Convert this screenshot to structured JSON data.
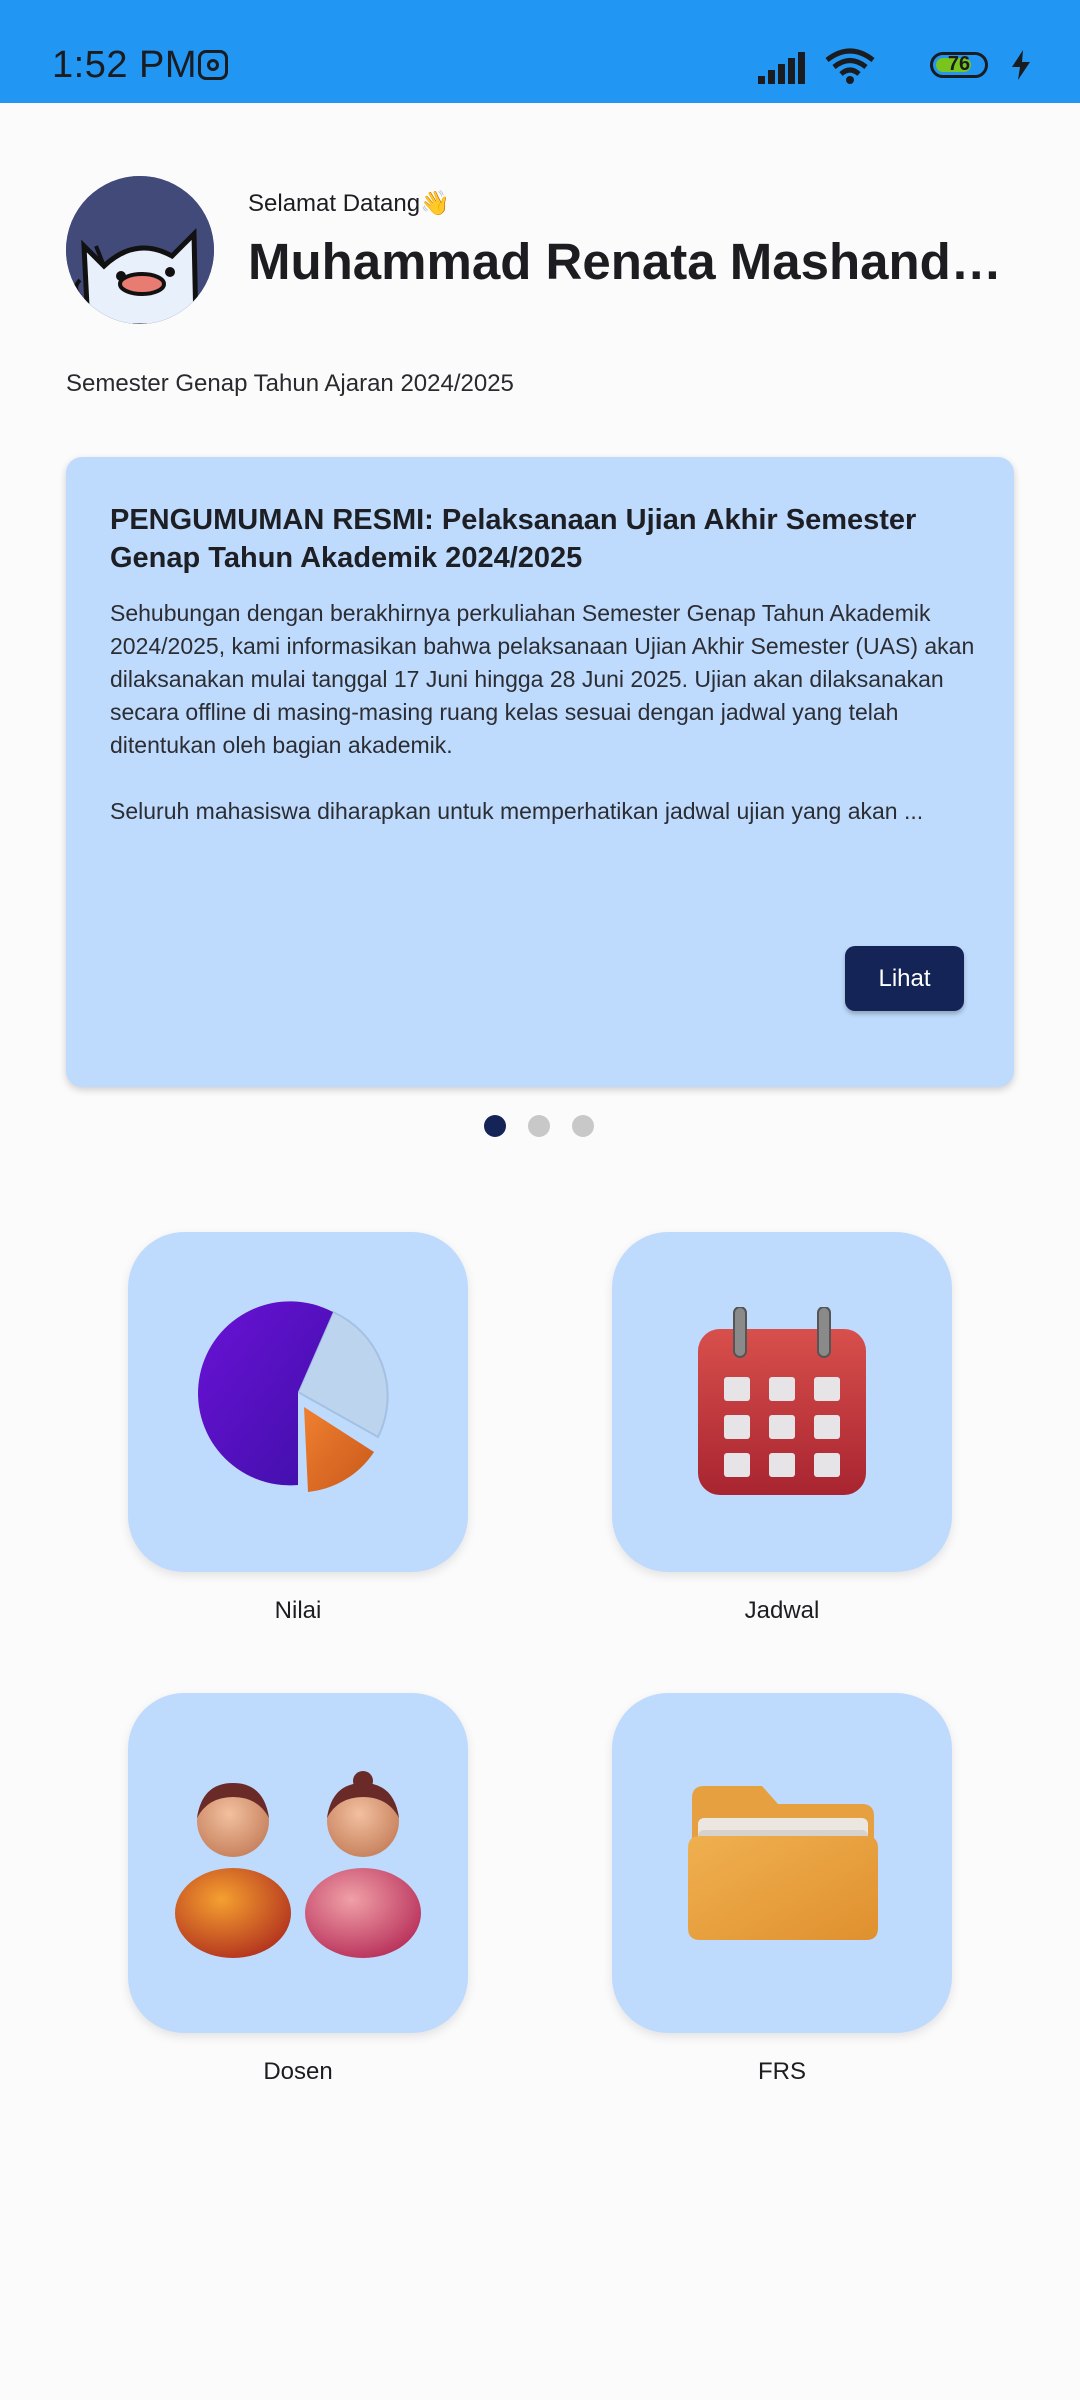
{
  "status_bar": {
    "time": "1:52 PM",
    "battery_level": "76",
    "battery_fraction": 0.76,
    "icons": [
      "notification-icon",
      "signal-icon",
      "wifi-icon",
      "battery-icon",
      "charging-icon"
    ]
  },
  "header": {
    "greeting": "Selamat Datang👋",
    "name": "Muhammad Renata Mashanda Putra",
    "semester": "Semester Genap Tahun Ajaran 2024/2025"
  },
  "announcement": {
    "title": "PENGUMUMAN RESMI: Pelaksanaan Ujian Akhir Semester Genap Tahun Akademik 2024/2025",
    "paragraph1": "Sehubungan dengan berakhirnya perkuliahan Semester Genap Tahun Akademik 2024/2025, kami informasikan bahwa pelaksanaan Ujian Akhir Semester (UAS) akan dilaksanakan mulai tanggal 17 Juni hingga 28 Juni 2025. Ujian akan dilaksanakan secara offline di masing-masing ruang kelas sesuai dengan jadwal yang telah ditentukan oleh bagian akademik.",
    "paragraph2": "Seluruh mahasiswa diharapkan untuk memperhatikan jadwal ujian yang akan ...",
    "button_label": "Lihat"
  },
  "carousel": {
    "total": 3,
    "active_index": 0,
    "colors": {
      "active": "#152456",
      "inactive": "#c8c8c8"
    }
  },
  "menu": {
    "items": [
      {
        "label": "Nilai",
        "icon": "pie-chart-icon"
      },
      {
        "label": "Jadwal",
        "icon": "calendar-icon"
      },
      {
        "label": "Dosen",
        "icon": "people-icon"
      },
      {
        "label": "FRS",
        "icon": "folder-icon"
      }
    ]
  },
  "colors": {
    "status_bar": "#2196f3",
    "card_background": "#bedbfd",
    "button_primary": "#152456",
    "page_background": "#fcfbfc"
  }
}
